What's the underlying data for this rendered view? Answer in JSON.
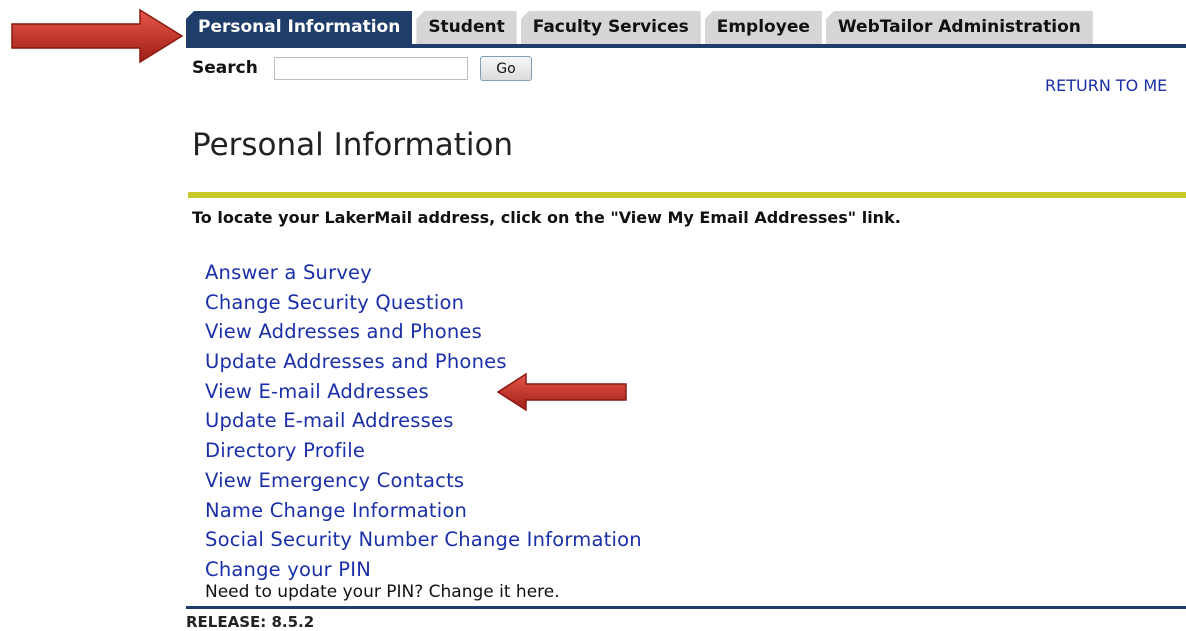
{
  "tabs": [
    {
      "label": "Personal Information",
      "active": true
    },
    {
      "label": "Student",
      "active": false
    },
    {
      "label": "Faculty Services",
      "active": false
    },
    {
      "label": "Employee",
      "active": false
    },
    {
      "label": "WebTailor Administration",
      "active": false
    }
  ],
  "search": {
    "label": "Search",
    "value": "",
    "button_label": "Go"
  },
  "return_link": "RETURN TO ME",
  "page_title": "Personal Information",
  "info_text": "To locate your LakerMail address, click on the \"View My Email Addresses\" link.",
  "menu": [
    "Answer a Survey",
    "Change Security Question",
    "View Addresses and Phones",
    "Update Addresses and Phones",
    "View E-mail Addresses",
    "Update E-mail Addresses",
    "Directory Profile",
    "View Emergency Contacts",
    "Name Change Information",
    "Social Security Number Change Information",
    "Change your PIN"
  ],
  "pin_description": "Need to update your PIN? Change it here.",
  "release": "RELEASE: 8.5.2",
  "colors": {
    "tab_active": "#1f3d6a",
    "tab_inactive": "#d6d6d6",
    "link": "#1a2fa8",
    "rule": "#c8c828",
    "arrow": "#c0392b"
  }
}
